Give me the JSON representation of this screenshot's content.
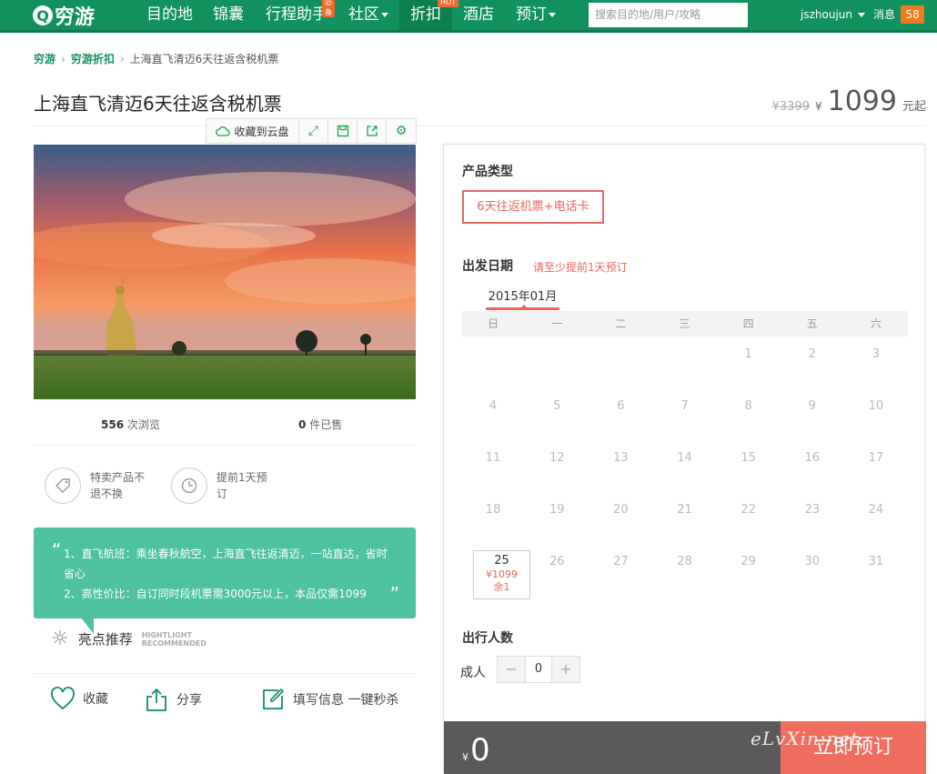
{
  "nav": {
    "logo_text": "穷游",
    "items": [
      {
        "label": "目的地"
      },
      {
        "label": "锦囊"
      },
      {
        "label": "行程助手",
        "badge": "必备"
      },
      {
        "label": "社区"
      },
      {
        "label": "折扣",
        "badge": "HOT"
      },
      {
        "label": "酒店"
      },
      {
        "label": "预订"
      }
    ],
    "search_placeholder": "搜索目的地/用户/攻略",
    "username": "jszhoujun",
    "messages_label": "消息",
    "messages_count": "58"
  },
  "breadcrumb": {
    "items": [
      "穷游",
      "穷游折扣",
      "上海直飞清迈6天往返含税机票"
    ]
  },
  "product": {
    "title": "上海直飞清迈6天往返含税机票",
    "old_price": "¥3399",
    "currency": "¥",
    "price": "1099",
    "price_unit": "元起"
  },
  "toolbar": {
    "save_cloud_label": "收藏到云盘"
  },
  "stats": {
    "views": "556",
    "views_label": "次浏览",
    "sold": "0",
    "sold_label": "件已售"
  },
  "features": [
    {
      "text": "特卖产品不退不换"
    },
    {
      "text": "提前1天预订"
    }
  ],
  "recommend": {
    "lines": [
      "1、直飞航班：乘坐春秋航空，上海直飞往返清迈，一站直达，省时省心",
      "2、高性价比：自订同时段机票需3000元以上，本品仅需1099"
    ],
    "title": "亮点推荐",
    "title_en_1": "HIGHTLIGHT",
    "title_en_2": "RECOMMENDED"
  },
  "actions": {
    "favorite": "收藏",
    "share": "分享",
    "fill_info": "填写信息 一键秒杀"
  },
  "booking": {
    "product_type_title": "产品类型",
    "product_option": "6天往返机票+电话卡",
    "date_title": "出发日期",
    "date_hint": "请至少提前1天预订",
    "month": "2015年01月",
    "weekdays": [
      "日",
      "一",
      "二",
      "三",
      "四",
      "五",
      "六"
    ],
    "selected": {
      "day": "25",
      "price": "¥1099",
      "left": "余1"
    },
    "travelers_title": "出行人数",
    "adult_label": "成人",
    "adult_count": "0",
    "total_currency": "¥",
    "total": "0",
    "book_label": "立即预订"
  },
  "watermark": "eLvXin.net"
}
